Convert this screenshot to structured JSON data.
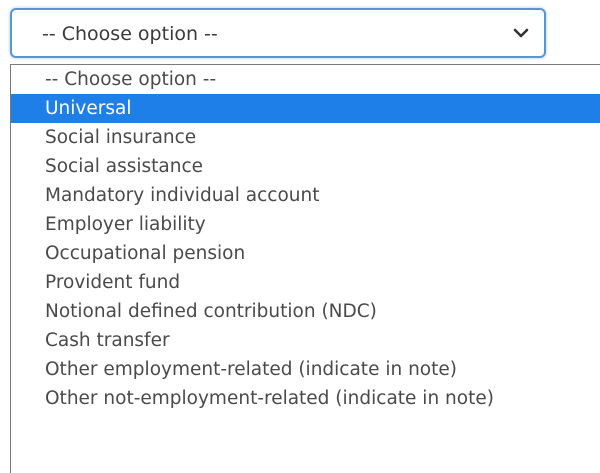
{
  "select": {
    "current_value": "-- Choose option --",
    "icon": "chevron-down-icon"
  },
  "options": [
    "-- Choose option --",
    "Universal",
    "Social insurance",
    "Social assistance",
    "Mandatory individual account",
    "Employer liability",
    "Occupational pension",
    "Provident fund",
    "Notional defined contribution (NDC)",
    "Cash transfer",
    "Other employment-related (indicate in note)",
    "Other not-employment-related (indicate in note)"
  ],
  "highlighted_option": "Universal",
  "colors": {
    "highlight": "#1e7fe8",
    "focus_border": "#5a93d8"
  }
}
